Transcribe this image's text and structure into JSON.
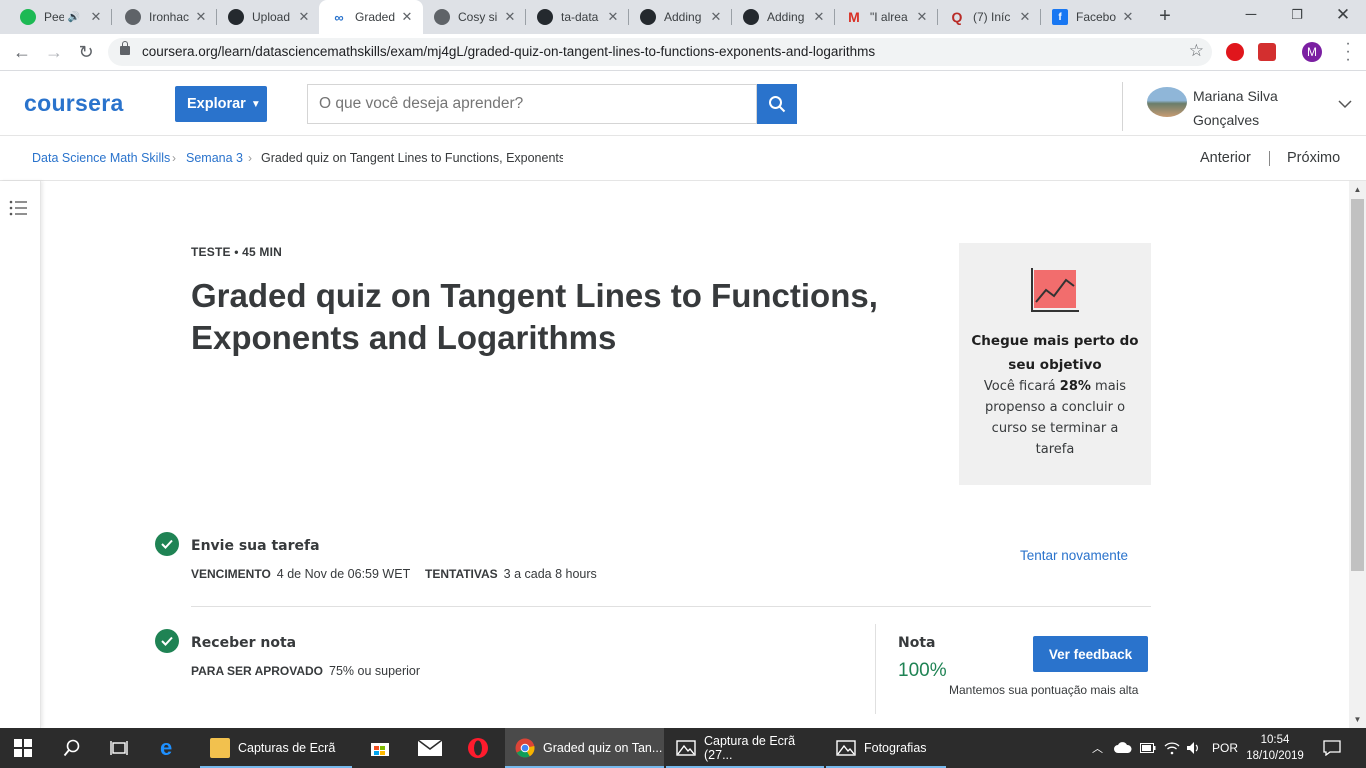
{
  "browser": {
    "tabs": [
      {
        "label": "Pee",
        "favicon": "spotify-icon",
        "color": "#1db954"
      },
      {
        "label": "Ironhac",
        "favicon": "globe-icon",
        "color": "#5f6368"
      },
      {
        "label": "Upload",
        "favicon": "github-icon",
        "color": "#24292e"
      },
      {
        "label": "Graded",
        "favicon": "coursera-icon",
        "color": "#2a73cc"
      },
      {
        "label": "Cosy si",
        "favicon": "globe-icon",
        "color": "#5f6368"
      },
      {
        "label": "ta-data",
        "favicon": "github-icon",
        "color": "#24292e"
      },
      {
        "label": "Adding",
        "favicon": "github-icon",
        "color": "#24292e"
      },
      {
        "label": "Adding",
        "favicon": "github-icon",
        "color": "#24292e"
      },
      {
        "label": "\"I alrea",
        "favicon": "gmail-icon",
        "color": "#d93025"
      },
      {
        "label": "(7) Iníc",
        "favicon": "quora-icon",
        "color": "#b92b27"
      },
      {
        "label": "Facebo",
        "favicon": "facebook-icon",
        "color": "#1877f2"
      }
    ],
    "url": "coursera.org/learn/datasciencemathskills/exam/mj4gL/graded-quiz-on-tangent-lines-to-functions-exponents-and-logarithms",
    "profile_initial": "M"
  },
  "header": {
    "logo": "coursera",
    "explore_label": "Explorar",
    "search_placeholder": "O que você deseja aprender?",
    "user_name": "Mariana Silva Gonçalves"
  },
  "breadcrumb": {
    "course": "Data Science Math Skills",
    "week": "Semana 3",
    "current": "Graded quiz on Tangent Lines to Functions, Exponents",
    "prev_label": "Anterior",
    "next_label": "Próximo"
  },
  "quiz": {
    "meta": "TESTE • 45 MIN",
    "title": "Graded quiz on Tangent Lines to Functions, Exponents and Logarithms"
  },
  "goal_card": {
    "title": "Chegue mais perto do seu objetivo",
    "text_before": "Você ficará ",
    "percent": "28%",
    "text_after": " mais propenso a concluir o curso se terminar a tarefa"
  },
  "submit_step": {
    "title": "Envie sua tarefa",
    "due_label": "VENCIMENTO",
    "due_value": "4 de Nov de 06:59 WET",
    "attempts_label": "TENTATIVAS",
    "attempts_value": "3 a cada 8 hours",
    "retry_label": "Tentar novamente"
  },
  "grade_step": {
    "title": "Receber nota",
    "pass_label": "PARA SER APROVADO",
    "pass_value": "75% ou superior",
    "grade_label": "Nota",
    "grade_value": "100%",
    "feedback_label": "Ver feedback",
    "keep_note": "Mantemos sua pontuação mais alta"
  },
  "taskbar": {
    "apps": [
      {
        "label": "Capturas de Ecrã"
      },
      {
        "label": "Graded quiz on Tan..."
      },
      {
        "label": "Captura de Ecrã (27..."
      },
      {
        "label": "Fotografias"
      }
    ],
    "language": "POR",
    "time": "10:54",
    "date": "18/10/2019"
  },
  "colors": {
    "accent": "#2a73cc",
    "success": "#1f8354"
  }
}
